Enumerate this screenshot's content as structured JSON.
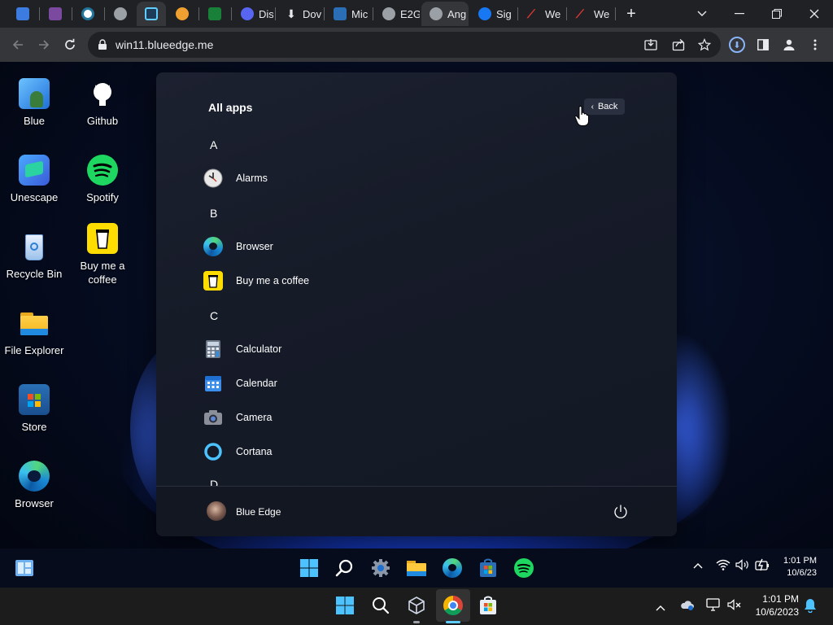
{
  "browser": {
    "tabs": [
      {
        "label": "",
        "icon": "windows-icon"
      },
      {
        "label": "",
        "icon": "purple-app-icon"
      },
      {
        "label": "",
        "icon": "wordpress-icon"
      },
      {
        "label": "",
        "icon": "globe-icon"
      },
      {
        "label": "",
        "icon": "settings-app-icon"
      },
      {
        "label": "",
        "icon": "coin-icon"
      },
      {
        "label": "",
        "icon": "sheet-icon"
      },
      {
        "label": "Disc",
        "icon": "discord-icon"
      },
      {
        "label": "Dov",
        "icon": "download-icon"
      },
      {
        "label": "Mic",
        "icon": "microsoft-store-icon"
      },
      {
        "label": "E2G",
        "icon": "globe-icon"
      },
      {
        "label": "Ang",
        "icon": "globe-icon"
      },
      {
        "label": "Sig",
        "icon": "facebook-icon"
      },
      {
        "label": "We",
        "icon": "red-logo-icon"
      },
      {
        "label": "We",
        "icon": "red-logo-icon"
      }
    ],
    "url": "win11.blueedge.me"
  },
  "desktop": {
    "icons": [
      {
        "label": "Blue"
      },
      {
        "label": "Github"
      },
      {
        "label": "Unescape"
      },
      {
        "label": "Spotify"
      },
      {
        "label": "Recycle Bin"
      },
      {
        "label": "Buy me a coffee"
      },
      {
        "label": "File Explorer"
      },
      {
        "label": "Store"
      },
      {
        "label": "Browser"
      }
    ]
  },
  "start_menu": {
    "title": "All apps",
    "back_label": "Back",
    "letters": [
      "A",
      "B",
      "C"
    ],
    "apps": [
      {
        "label": "Alarms"
      },
      {
        "label": "Browser"
      },
      {
        "label": "Buy me a coffee"
      },
      {
        "label": "Calculator"
      },
      {
        "label": "Calendar"
      },
      {
        "label": "Camera"
      },
      {
        "label": "Cortana"
      }
    ],
    "user_name": "Blue Edge"
  },
  "inner_taskbar": {
    "time": "1:01 PM",
    "date": "10/6/23"
  },
  "os_taskbar": {
    "time": "1:01 PM",
    "date": "10/6/2023"
  },
  "colors": {
    "accent": "#60cdff",
    "start_bg": "#161b28",
    "chrome_dark": "#202124",
    "chrome_toolbar": "#35363a"
  }
}
